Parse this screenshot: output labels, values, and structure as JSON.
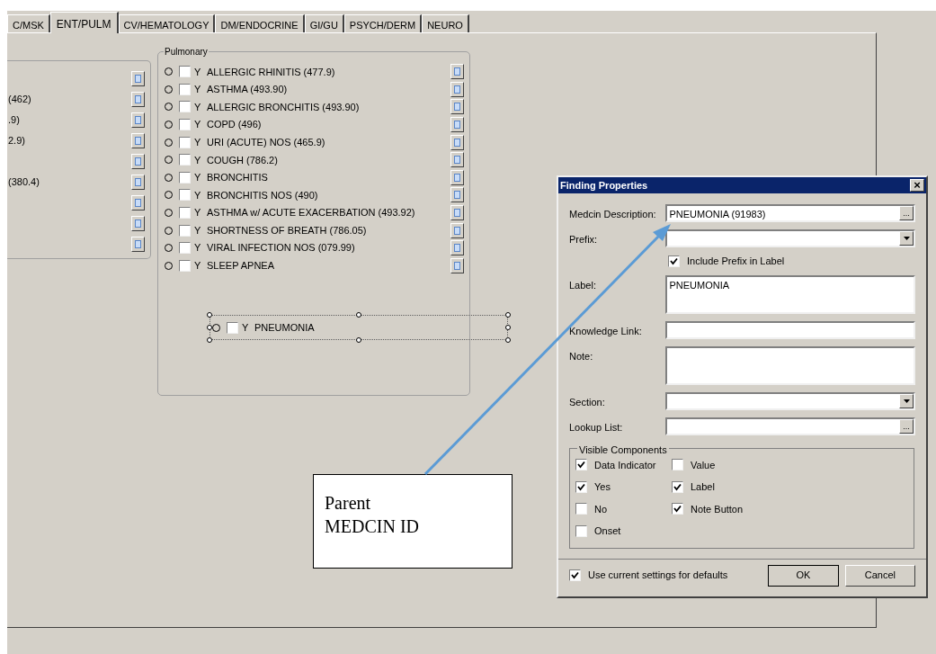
{
  "tabs": [
    {
      "label": "C/MSK",
      "selected": false
    },
    {
      "label": "ENT/PULM",
      "selected": true
    },
    {
      "label": "CV/HEMATOLOGY",
      "selected": false
    },
    {
      "label": "DM/ENDOCRINE",
      "selected": false
    },
    {
      "label": "GI/GU",
      "selected": false
    },
    {
      "label": "PSYCH/DERM",
      "selected": false
    },
    {
      "label": "NEURO",
      "selected": false
    }
  ],
  "left_group": {
    "rows": [
      {
        "kind": "blank"
      },
      {
        "kind": "text",
        "text": "(462)"
      },
      {
        "kind": "text",
        "text": ".9)"
      },
      {
        "kind": "text",
        "text": "2.9)"
      },
      {
        "kind": "blank"
      },
      {
        "kind": "text",
        "text": "(380.4)"
      },
      {
        "kind": "blank"
      },
      {
        "kind": "blank"
      },
      {
        "kind": "blank"
      }
    ]
  },
  "pulmonary": {
    "title": "Pulmonary",
    "findings": [
      {
        "yes": "Y",
        "label": "ALLERGIC RHINITIS (477.9)",
        "checked": false
      },
      {
        "yes": "Y",
        "label": "ASTHMA (493.90)",
        "checked": false
      },
      {
        "yes": "Y",
        "label": "ALLERGIC BRONCHITIS (493.90)",
        "checked": false
      },
      {
        "yes": "Y",
        "label": "COPD (496)",
        "checked": false
      },
      {
        "yes": "Y",
        "label": "URI (ACUTE) NOS (465.9)",
        "checked": false
      },
      {
        "yes": "Y",
        "label": "COUGH (786.2)",
        "checked": false
      },
      {
        "yes": "Y",
        "label": "BRONCHITIS",
        "checked": false
      },
      {
        "yes": "Y",
        "label": "BRONCHITIS NOS (490)",
        "checked": false
      },
      {
        "yes": "Y",
        "label": "ASTHMA w/ ACUTE EXACERBATION (493.92)",
        "checked": false
      },
      {
        "yes": "Y",
        "label": "SHORTNESS OF BREATH (786.05)",
        "checked": false
      },
      {
        "yes": "Y",
        "label": "VIRAL INFECTION NOS (079.99)",
        "checked": false
      },
      {
        "yes": "Y",
        "label": "SLEEP APNEA",
        "checked": false
      }
    ],
    "designer_finding": {
      "yes": "Y",
      "label": "PNEUMONIA",
      "checked": false,
      "selected": true
    }
  },
  "dialog": {
    "title": "Finding Properties",
    "close": "×",
    "fields": [
      {
        "kind": "lookup",
        "label": "Medcin Description:",
        "value": "PNEUMONIA (91983)",
        "button": "..."
      },
      {
        "kind": "combo",
        "label": "Prefix:"
      },
      {
        "kind": "check",
        "label": "Include Prefix in Label",
        "checked": true
      },
      {
        "kind": "memo",
        "label": "Label:",
        "value": "PNEUMONIA"
      },
      {
        "kind": "text",
        "label": "Knowledge Link:"
      },
      {
        "kind": "memo",
        "label": "Note:"
      },
      {
        "kind": "combo",
        "label": "Section:"
      },
      {
        "kind": "lookup",
        "label": "Lookup List:",
        "button": "..."
      }
    ],
    "visible_components": {
      "title": "Visible Components",
      "items": [
        {
          "label": "Data Indicator",
          "checked": true
        },
        {
          "label": "Value",
          "checked": false
        },
        {
          "label": "Yes",
          "checked": true
        },
        {
          "label": "Label",
          "checked": true
        },
        {
          "label": "No",
          "checked": false
        },
        {
          "label": "Note Button",
          "checked": true
        },
        {
          "label": "Onset",
          "checked": false
        }
      ]
    },
    "use_defaults": {
      "label": "Use current settings for defaults",
      "checked": true
    },
    "buttons": [
      "OK",
      "Cancel"
    ]
  },
  "callout": {
    "text": "Parent MEDCIN ID"
  }
}
